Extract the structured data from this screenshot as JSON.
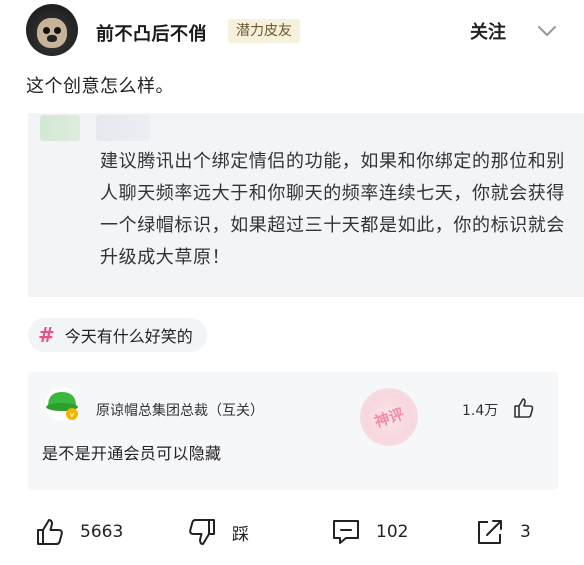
{
  "post": {
    "author": {
      "name": "前不凸后不俏",
      "badge": "潜力皮友",
      "follow_label": "关注"
    },
    "text": "这个创意怎么样。",
    "quote": {
      "text": "建议腾讯出个绑定情侣的功能，如果和你绑定的那位和别人聊天频率远大于和你聊天的频率连续七天，你就会获得一个绿帽标识，如果超过三十天都是如此，你的标识就会升级成大草原！"
    },
    "topic": {
      "icon": "hashtag-icon",
      "label": "今天有什么好笑的"
    }
  },
  "top_comment": {
    "author": "原谅帽总集团总裁（互关）",
    "likes": "1.4万",
    "text": "是不是开通会员可以隐藏",
    "stamp_text": "神评",
    "colors": {
      "stamp": "#f07e9a",
      "avatar_green": "#3cb93c",
      "vip_gold": "#f5b400"
    }
  },
  "actions": {
    "like_count": "5663",
    "dislike_label": "踩",
    "comment_count": "102",
    "share_count": "3"
  },
  "colors": {
    "topic_hash": "#e9508c",
    "badge_bg": "#f7f0dc",
    "badge_text": "#6b5a2e"
  }
}
